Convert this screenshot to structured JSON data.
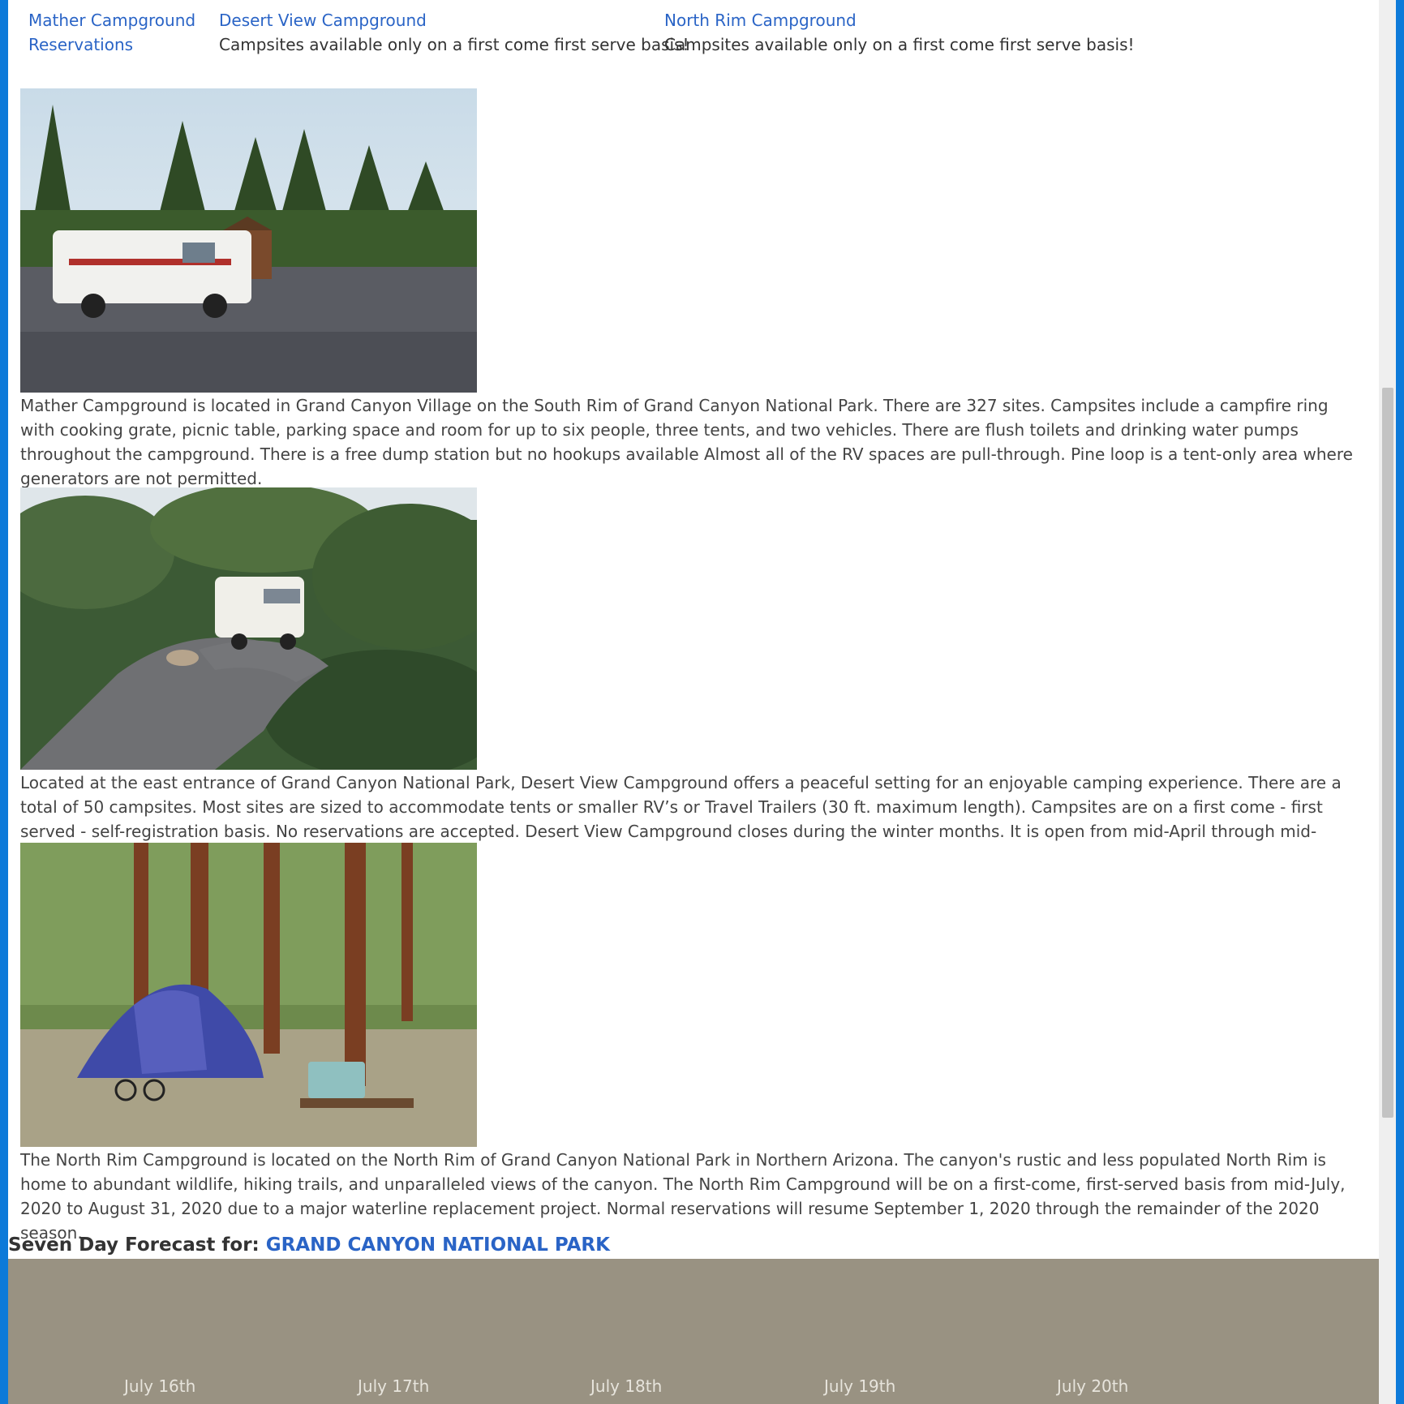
{
  "campgrounds_nav": [
    {
      "link": "Mather Campground Reservations",
      "note": ""
    },
    {
      "link": "Desert View Campground",
      "note": "Campsites available only on a first come first serve basis!"
    },
    {
      "link": "North Rim Campground",
      "note": "Campsites available only on a first come first serve basis!"
    }
  ],
  "nav_mather_line1": "Mather Campground",
  "nav_mather_line2": "Reservations",
  "sections": [
    {
      "photo": "mather-rv-entrance-photo",
      "description": "Mather Campground is located in Grand Canyon Village on the South Rim of Grand Canyon National Park. There are 327 sites. Campsites include a campfire ring with cooking grate, picnic table, parking space and room for up to six people, three tents, and two vehicles. There are flush toilets and drinking water pumps throughout the campground. There is a free dump station but no hookups available Almost all of the RV spaces are pull-through. Pine loop is a tent-only area where generators are not permitted."
    },
    {
      "photo": "desert-view-rv-photo",
      "description": "Located at the east entrance of Grand Canyon National Park, Desert View Campground offers a peaceful setting for an enjoyable camping experience. There are a total of 50 campsites. Most sites are sized to accommodate tents or smaller RV’s or Travel Trailers (30 ft. maximum length). Campsites are on a first come - first served - self-registration basis. No reservations are accepted. Desert View Campground closes during the winter months. It is open from mid-April through mid-October."
    },
    {
      "photo": "north-rim-tent-photo",
      "description": "The North Rim Campground is located on the North Rim of Grand Canyon National Park in Northern Arizona. The canyon's rustic and less populated North Rim is home to abundant wildlife, hiking trails, and unparalleled views of the canyon. The North Rim Campground will be on a first-come, first-served basis from mid-July, 2020 to August 31, 2020 due to a major waterline replacement project. Normal reservations will resume September 1, 2020 through the remainder of the 2020 season."
    }
  ],
  "forecast": {
    "label": "Seven Day Forecast for:",
    "location": "GRAND CANYON NATIONAL PARK",
    "days": [
      "July 16th",
      "July 17th",
      "July 18th",
      "July 19th",
      "July 20th"
    ]
  },
  "colors": {
    "link": "#2a64c6",
    "accent": "#0d7ad9",
    "forecast_bg": "#999282"
  }
}
